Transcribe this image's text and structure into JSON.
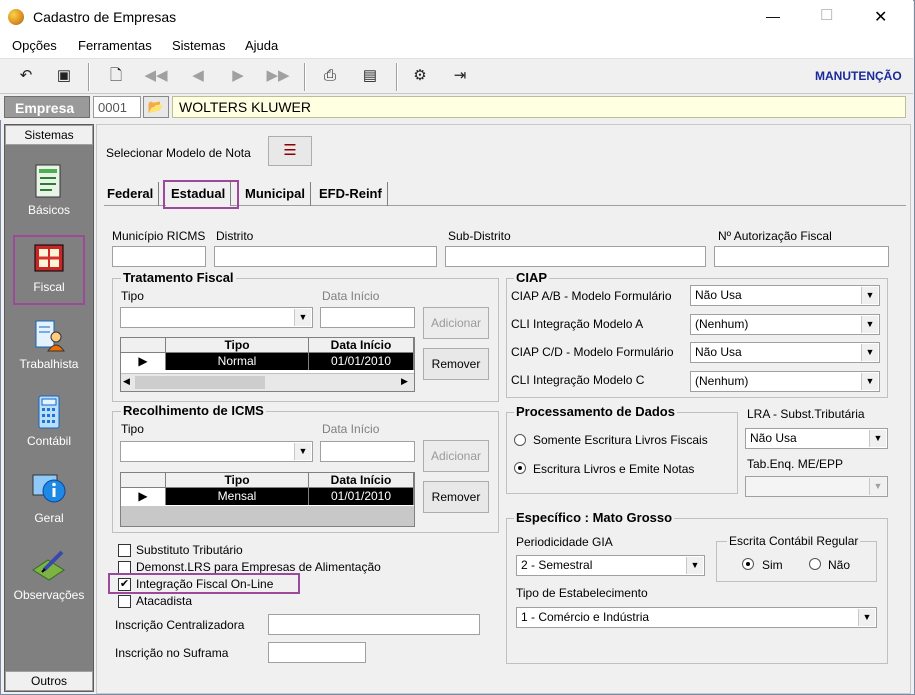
{
  "window": {
    "title": "Cadastro de Empresas",
    "minimize": "—",
    "maximize": "☐",
    "close": "✕"
  },
  "menu": [
    "Opções",
    "Ferramentas",
    "Sistemas",
    "Ajuda"
  ],
  "toolbar": {
    "mode_label": "MANUTENÇÃO"
  },
  "empresa": {
    "label": "Empresa",
    "code": "0001",
    "name": "WOLTERS KLUWER"
  },
  "sidebar": {
    "header": "Sistemas",
    "footer": "Outros",
    "items": [
      "Básicos",
      "Fiscal",
      "Trabalhista",
      "Contábil",
      "Geral",
      "Observações"
    ],
    "selected": "Fiscal"
  },
  "modelo_nota": {
    "label": "Selecionar Modelo de Nota"
  },
  "tabs": [
    "Federal",
    "Estadual",
    "Municipal",
    "EFD-Reinf"
  ],
  "active_tab": "Estadual",
  "fields": {
    "municipio_ricms": "Município RICMS",
    "distrito": "Distrito",
    "sub_distrito": "Sub-Distrito",
    "autorizacao": "Nº Autorização Fiscal"
  },
  "tratamento": {
    "title": "Tratamento Fiscal",
    "tipo_label": "Tipo",
    "data_label": "Data Início",
    "add": "Adicionar",
    "remove": "Remover",
    "col_tipo": "Tipo",
    "col_data": "Data Início",
    "row_tipo": "Normal",
    "row_data": "01/01/2010"
  },
  "recolhimento": {
    "title": "Recolhimento de ICMS",
    "tipo_label": "Tipo",
    "data_label": "Data Início",
    "add": "Adicionar",
    "remove": "Remover",
    "col_tipo": "Tipo",
    "col_data": "Data Início",
    "row_tipo": "Mensal",
    "row_data": "01/01/2010"
  },
  "ciap": {
    "title": "CIAP",
    "rows": [
      {
        "label": "CIAP  A/B - Modelo Formulário",
        "value": "Não Usa"
      },
      {
        "label": "CLI Integração Modelo A",
        "value": "(Nenhum)"
      },
      {
        "label": "CIAP C/D - Modelo Formulário",
        "value": "Não Usa"
      },
      {
        "label": "CLI Integração Modelo C",
        "value": "(Nenhum)"
      }
    ]
  },
  "processamento": {
    "title": "Processamento de Dados",
    "opt1": "Somente Escritura Livros Fiscais",
    "opt2": "Escritura Livros e Emite Notas"
  },
  "lra": {
    "label": "LRA - Subst.Tributária",
    "value": "Não Usa",
    "tab_label": "Tab.Enq. ME/EPP",
    "tab_value": ""
  },
  "checks": {
    "substituto": "Substituto Tributário",
    "demonst": "Demonst.LRS para Empresas de Alimentação",
    "integracao": "Integração Fiscal On-Line",
    "atacadista": "Atacadista"
  },
  "inscricao": {
    "centralizadora": "Inscrição Centralizadora",
    "suframa": "Inscrição no Suframa"
  },
  "especifico": {
    "title": "Específico : Mato Grosso",
    "periodicidade_label": "Periodicidade GIA",
    "periodicidade_value": "2 - Semestral",
    "escrita_title": "Escrita Contábil Regular",
    "sim": "Sim",
    "nao": "Não",
    "estab_label": "Tipo de Estabelecimento",
    "estab_value": "1 - Comércio e Indústria"
  },
  "colors": {
    "highlight": "#9b4a9b",
    "mode_label": "#1a2a9a",
    "sidebar": "#808080",
    "company_bg": "#ffffe1"
  }
}
